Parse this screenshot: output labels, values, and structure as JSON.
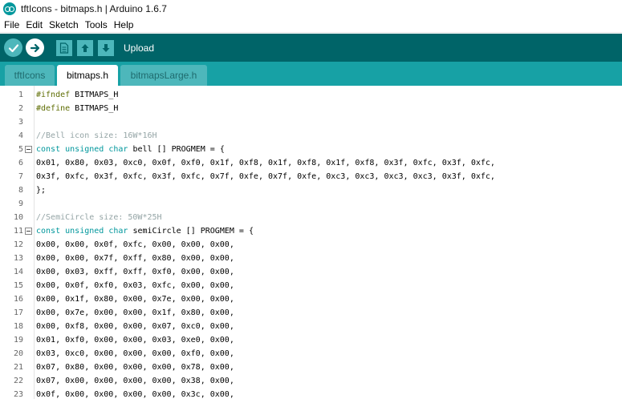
{
  "window": {
    "title": "tftIcons - bitmaps.h | Arduino 1.6.7"
  },
  "menu": [
    "File",
    "Edit",
    "Sketch",
    "Tools",
    "Help"
  ],
  "toolbar": {
    "label": "Upload"
  },
  "tabs": [
    {
      "label": "tftIcons",
      "active": false
    },
    {
      "label": "bitmaps.h",
      "active": true
    },
    {
      "label": "bitmapsLarge.h",
      "active": false
    }
  ],
  "colors": {
    "toolbar": "#006468",
    "tabstrip": "#17a1a5",
    "accent": "#4db7bb",
    "keyword": "#00979c",
    "preprocessor": "#5e6d03",
    "comment": "#95a5a6"
  },
  "editor": {
    "lines": [
      {
        "n": "1",
        "fold": false,
        "parts": [
          {
            "c": "pp",
            "t": "#ifndef"
          },
          {
            "c": "tx",
            "t": " BITMAPS_H"
          }
        ]
      },
      {
        "n": "2",
        "fold": false,
        "parts": [
          {
            "c": "pp",
            "t": "#define"
          },
          {
            "c": "tx",
            "t": " BITMAPS_H"
          }
        ]
      },
      {
        "n": "3",
        "fold": false,
        "parts": []
      },
      {
        "n": "4",
        "fold": false,
        "parts": [
          {
            "c": "cm",
            "t": "//Bell icon size: 16W*16H"
          }
        ]
      },
      {
        "n": "5",
        "fold": true,
        "parts": [
          {
            "c": "kw",
            "t": "const"
          },
          {
            "c": "tx",
            "t": " "
          },
          {
            "c": "kw",
            "t": "unsigned"
          },
          {
            "c": "tx",
            "t": " "
          },
          {
            "c": "kw",
            "t": "char"
          },
          {
            "c": "tx",
            "t": " bell [] PROGMEM = {"
          }
        ]
      },
      {
        "n": "6",
        "fold": false,
        "parts": [
          {
            "c": "tx",
            "t": "0x01, 0x80, 0x03, 0xc0, 0x0f, 0xf0, 0x1f, 0xf8, 0x1f, 0xf8, 0x1f, 0xf8, 0x3f, 0xfc, 0x3f, 0xfc,"
          }
        ]
      },
      {
        "n": "7",
        "fold": false,
        "parts": [
          {
            "c": "tx",
            "t": "0x3f, 0xfc, 0x3f, 0xfc, 0x3f, 0xfc, 0x7f, 0xfe, 0x7f, 0xfe, 0xc3, 0xc3, 0xc3, 0xc3, 0x3f, 0xfc,"
          }
        ]
      },
      {
        "n": "8",
        "fold": false,
        "parts": [
          {
            "c": "tx",
            "t": "};"
          }
        ]
      },
      {
        "n": "9",
        "fold": false,
        "parts": []
      },
      {
        "n": "10",
        "fold": false,
        "parts": [
          {
            "c": "cm",
            "t": "//SemiCircle size: 50W*25H"
          }
        ]
      },
      {
        "n": "11",
        "fold": true,
        "parts": [
          {
            "c": "kw",
            "t": "const"
          },
          {
            "c": "tx",
            "t": " "
          },
          {
            "c": "kw",
            "t": "unsigned"
          },
          {
            "c": "tx",
            "t": " "
          },
          {
            "c": "kw",
            "t": "char"
          },
          {
            "c": "tx",
            "t": " semiCircle [] PROGMEM = {"
          }
        ]
      },
      {
        "n": "12",
        "fold": false,
        "parts": [
          {
            "c": "tx",
            "t": "0x00, 0x00, 0x0f, 0xfc, 0x00, 0x00, 0x00,"
          }
        ]
      },
      {
        "n": "13",
        "fold": false,
        "parts": [
          {
            "c": "tx",
            "t": "0x00, 0x00, 0x7f, 0xff, 0x80, 0x00, 0x00,"
          }
        ]
      },
      {
        "n": "14",
        "fold": false,
        "parts": [
          {
            "c": "tx",
            "t": "0x00, 0x03, 0xff, 0xff, 0xf0, 0x00, 0x00,"
          }
        ]
      },
      {
        "n": "15",
        "fold": false,
        "parts": [
          {
            "c": "tx",
            "t": "0x00, 0x0f, 0xf0, 0x03, 0xfc, 0x00, 0x00,"
          }
        ]
      },
      {
        "n": "16",
        "fold": false,
        "parts": [
          {
            "c": "tx",
            "t": "0x00, 0x1f, 0x80, 0x00, 0x7e, 0x00, 0x00,"
          }
        ]
      },
      {
        "n": "17",
        "fold": false,
        "parts": [
          {
            "c": "tx",
            "t": "0x00, 0x7e, 0x00, 0x00, 0x1f, 0x80, 0x00,"
          }
        ]
      },
      {
        "n": "18",
        "fold": false,
        "parts": [
          {
            "c": "tx",
            "t": "0x00, 0xf8, 0x00, 0x00, 0x07, 0xc0, 0x00,"
          }
        ]
      },
      {
        "n": "19",
        "fold": false,
        "parts": [
          {
            "c": "tx",
            "t": "0x01, 0xf0, 0x00, 0x00, 0x03, 0xe0, 0x00,"
          }
        ]
      },
      {
        "n": "20",
        "fold": false,
        "parts": [
          {
            "c": "tx",
            "t": "0x03, 0xc0, 0x00, 0x00, 0x00, 0xf0, 0x00,"
          }
        ]
      },
      {
        "n": "21",
        "fold": false,
        "parts": [
          {
            "c": "tx",
            "t": "0x07, 0x80, 0x00, 0x00, 0x00, 0x78, 0x00,"
          }
        ]
      },
      {
        "n": "22",
        "fold": false,
        "parts": [
          {
            "c": "tx",
            "t": "0x07, 0x00, 0x00, 0x00, 0x00, 0x38, 0x00,"
          }
        ]
      },
      {
        "n": "23",
        "fold": false,
        "parts": [
          {
            "c": "tx",
            "t": "0x0f, 0x00, 0x00, 0x00, 0x00, 0x3c, 0x00,"
          }
        ]
      }
    ]
  }
}
